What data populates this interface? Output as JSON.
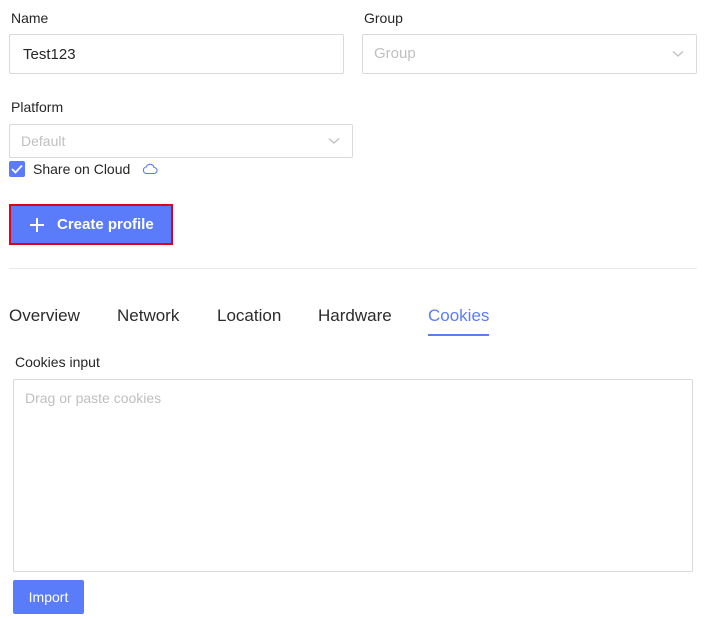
{
  "form": {
    "name_label": "Name",
    "name_value": "Test123",
    "group_label": "Group",
    "group_placeholder": "Group",
    "platform_label": "Platform",
    "platform_placeholder": "Default",
    "share_label": "Share on Cloud",
    "share_checked": true,
    "create_button_label": "Create profile"
  },
  "tabs": [
    {
      "label": "Overview"
    },
    {
      "label": "Network"
    },
    {
      "label": "Location"
    },
    {
      "label": "Hardware"
    },
    {
      "label": "Cookies",
      "active": true
    }
  ],
  "cookies": {
    "input_label": "Cookies input",
    "placeholder": "Drag or paste cookies",
    "import_button_label": "Import"
  },
  "icons": {
    "select_arrow": "chevron-down-icon",
    "cloud": "cloud-icon",
    "check": "check-icon",
    "plus": "plus-icon"
  },
  "colors": {
    "accent": "#5b7cfa",
    "highlight_border": "#e0001b"
  }
}
